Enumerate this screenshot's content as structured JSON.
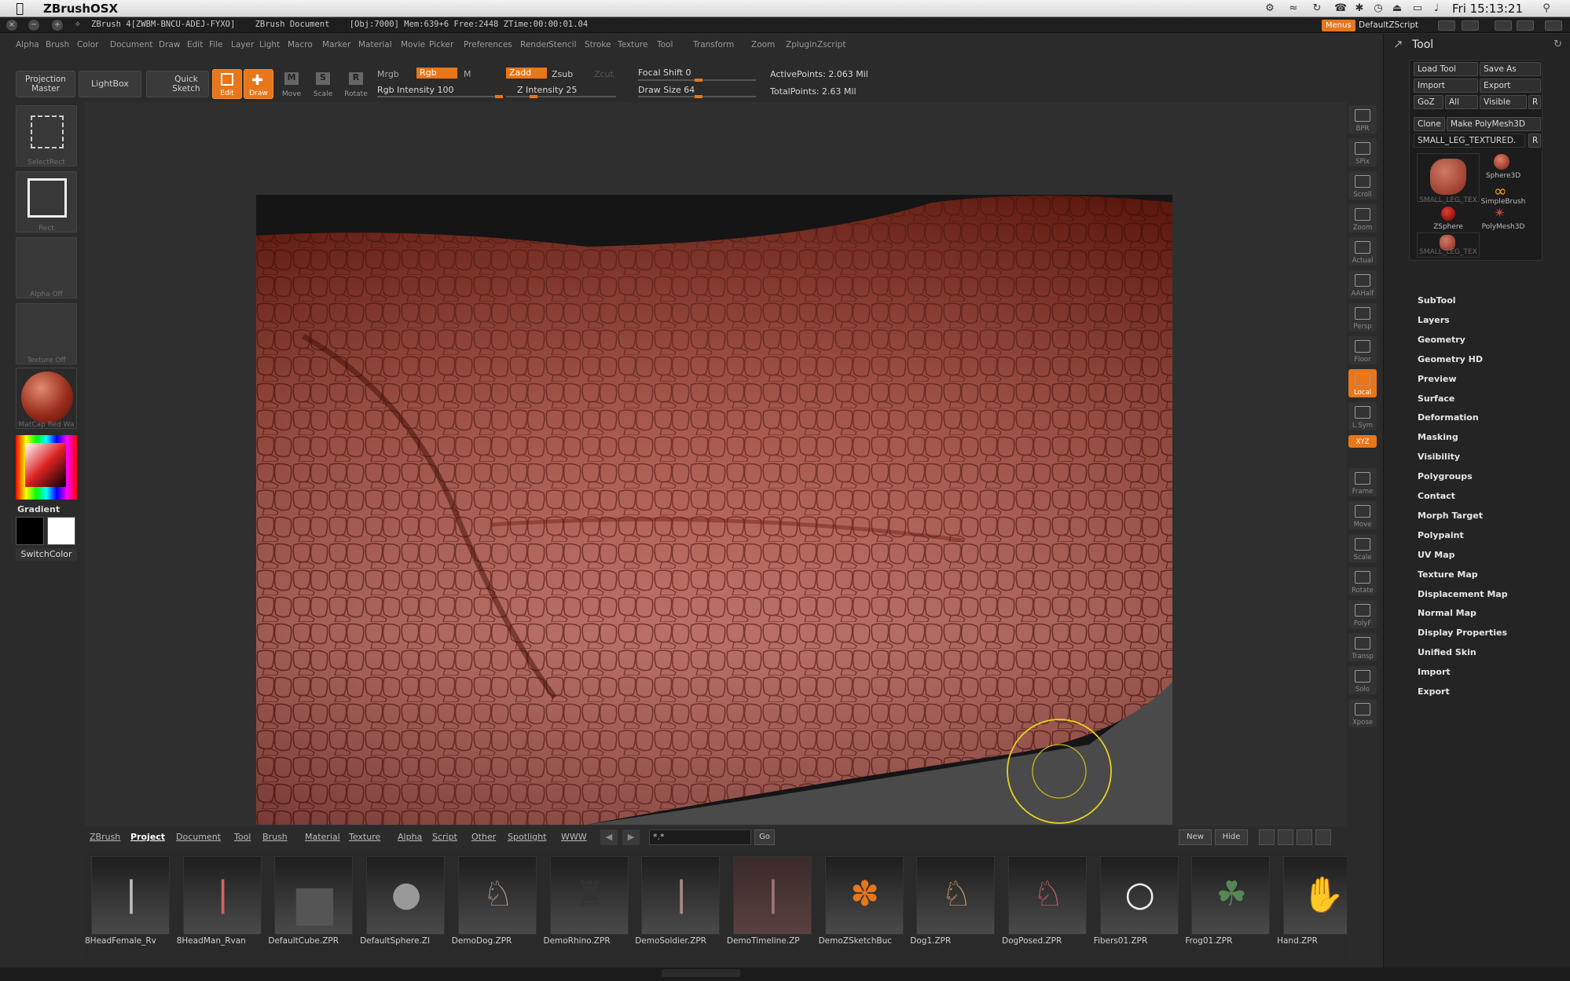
{
  "macbar": {
    "app_name": "ZBrushOSX",
    "clock": "Fri 15:13:21"
  },
  "titlebar": {
    "text": "ZBrush 4[ZWBM-BNCU-ADEJ-FYXO]    ZBrush Document    [Obj:7000] Mem:639+6 Free:2448 ZTime:00:00:01.04",
    "menus_label": "Menus",
    "script_label": "DefaultZScript"
  },
  "menubar": [
    "Alpha",
    "Brush",
    "Color",
    "Document",
    "Draw",
    "Edit",
    "File",
    "Layer",
    "Light",
    "Macro",
    "Marker",
    "Material",
    "Movie",
    "Picker",
    "Preferences",
    "Render",
    "Stencil",
    "Stroke",
    "Texture",
    "Tool",
    "Transform",
    "Zoom",
    "Zplugin",
    "Zscript"
  ],
  "shelf": {
    "projection_master": "Projection Master",
    "lightbox": "LightBox",
    "quick_sketch": "Quick Sketch",
    "edit": "Edit",
    "draw": "Draw",
    "move": "Move",
    "scale": "Scale",
    "rotate": "Rotate",
    "mrgb": "Mrgb",
    "rgb": "Rgb",
    "m": "M",
    "zadd": "Zadd",
    "zsub": "Zsub",
    "zcut": "Zcut",
    "rgb_intensity": "Rgb Intensity 100",
    "z_intensity": "Z Intensity 25",
    "focal_shift": "Focal Shift 0",
    "draw_size": "Draw Size 64",
    "active_points": "ActivePoints: 2.063 Mil",
    "total_points": "TotalPoints: 2.63 Mil",
    "rgb_intensity_value": 100,
    "z_intensity_value": 25,
    "draw_size_value": 64
  },
  "left": {
    "selectrect": "SelectRect",
    "rect": "Rect",
    "alpha": "Alpha Off",
    "texture": "Texture Off",
    "material": "MatCap Red Wa",
    "gradient": "Gradient",
    "switchcolor": "SwitchColor"
  },
  "rstrip": [
    {
      "label": "BPR"
    },
    {
      "label": "SPix"
    },
    {
      "label": "Scroll"
    },
    {
      "label": "Zoom"
    },
    {
      "label": "Actual"
    },
    {
      "label": "AAHalf"
    },
    {
      "label": "Persp"
    },
    {
      "label": "Floor"
    },
    {
      "label": "Local"
    },
    {
      "label": "L.Sym"
    },
    {
      "label": "XYZ"
    },
    {
      "label": "Frame"
    },
    {
      "label": "Move"
    },
    {
      "label": "Scale"
    },
    {
      "label": "Rotate"
    },
    {
      "label": "PolyF"
    },
    {
      "label": "Transp"
    },
    {
      "label": "Solo"
    },
    {
      "label": "Xpose"
    }
  ],
  "tool": {
    "title": "Tool",
    "load_tool": "Load Tool",
    "save_as": "Save As",
    "import": "Import",
    "export": "Export",
    "goz": "GoZ",
    "all": "All",
    "visible": "Visible",
    "r": "R",
    "clone": "Clone",
    "make_polymesh": "Make PolyMesh3D",
    "current": "SMALL_LEG_TEXTURED.",
    "thumbs": [
      "SMALL_LEG_TEX",
      "Sphere3D",
      "SimpleBrush",
      "ZSphere",
      "PolyMesh3D",
      "SMALL_LEG_TEX"
    ],
    "sections": [
      "SubTool",
      "Layers",
      "Geometry",
      "Geometry HD",
      "Preview",
      "Surface",
      "Deformation",
      "Masking",
      "Visibility",
      "Polygroups",
      "Contact",
      "Morph Target",
      "Polypaint",
      "UV Map",
      "Texture Map",
      "Displacement Map",
      "Normal Map",
      "Display Properties",
      "Unified Skin",
      "Import",
      "Export"
    ]
  },
  "lightbox": {
    "tabs": [
      "ZBrush",
      "Project",
      "Document",
      "Tool",
      "Brush",
      "Material",
      "Texture",
      "Alpha",
      "Script",
      "Other",
      "Spotlight",
      "WWW"
    ],
    "active_tab": "Project",
    "search": "*.*",
    "go": "Go",
    "new": "New",
    "hide": "Hide",
    "items": [
      "8HeadFemale_Rv",
      "8HeadMan_Rvan",
      "DefaultCube.ZPR",
      "DefaultSphere.ZI",
      "DemoDog.ZPR",
      "DemoRhino.ZPR",
      "DemoSoldier.ZPR",
      "DemoTimeline.ZP",
      "DemoZSketchBuc",
      "Dog1.ZPR",
      "DogPosed.ZPR",
      "Fibers01.ZPR",
      "Frog01.ZPR",
      "Hand.ZPR"
    ]
  }
}
